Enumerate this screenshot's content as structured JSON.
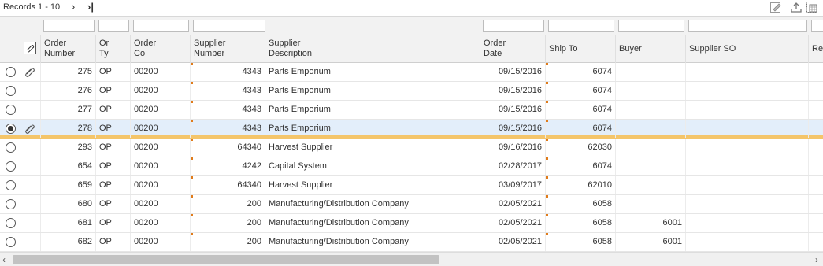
{
  "toolbar": {
    "records_label": "Records 1 - 10",
    "next_glyph": "›",
    "last_glyph": "›|",
    "icons": [
      "personalize-icon",
      "export-icon",
      "grid-format-icon"
    ]
  },
  "columns": [
    {
      "key": "order_number",
      "label": "Order Number"
    },
    {
      "key": "or_ty",
      "label": "Or Ty"
    },
    {
      "key": "order_co",
      "label": "Order Co"
    },
    {
      "key": "supplier_number",
      "label": "Supplier Number"
    },
    {
      "key": "supplier_description",
      "label": "Supplier Description"
    },
    {
      "key": "order_date",
      "label": "Order Date"
    },
    {
      "key": "ship_to",
      "label": "Ship To"
    },
    {
      "key": "buyer",
      "label": "Buyer"
    },
    {
      "key": "supplier_so",
      "label": "Supplier SO"
    },
    {
      "key": "re",
      "label": "Re"
    }
  ],
  "header": {
    "order_number_1": "Order",
    "order_number_2": "Number",
    "or_ty_1": "Or",
    "or_ty_2": "Ty",
    "order_co_1": "Order",
    "order_co_2": "Co",
    "supplier_number_1": "Supplier",
    "supplier_number_2": "Number",
    "supplier_description_1": "Supplier",
    "supplier_description_2": "Description",
    "order_date_1": "Order",
    "order_date_2": "Date",
    "ship_to": "Ship To",
    "buyer": "Buyer",
    "supplier_so": "Supplier SO",
    "re": "Re"
  },
  "rows": [
    {
      "selected": false,
      "attachment": true,
      "order_number": "275",
      "or_ty": "OP",
      "order_co": "00200",
      "supplier_number": "4343",
      "supplier_description": "Parts Emporium",
      "order_date": "09/15/2016",
      "ship_to": "6074",
      "buyer": "",
      "supplier_so": ""
    },
    {
      "selected": false,
      "attachment": false,
      "order_number": "276",
      "or_ty": "OP",
      "order_co": "00200",
      "supplier_number": "4343",
      "supplier_description": "Parts Emporium",
      "order_date": "09/15/2016",
      "ship_to": "6074",
      "buyer": "",
      "supplier_so": ""
    },
    {
      "selected": false,
      "attachment": false,
      "order_number": "277",
      "or_ty": "OP",
      "order_co": "00200",
      "supplier_number": "4343",
      "supplier_description": "Parts Emporium",
      "order_date": "09/15/2016",
      "ship_to": "6074",
      "buyer": "",
      "supplier_so": ""
    },
    {
      "selected": true,
      "attachment": true,
      "order_number": "278",
      "or_ty": "OP",
      "order_co": "00200",
      "supplier_number": "4343",
      "supplier_description": "Parts Emporium",
      "order_date": "09/15/2016",
      "ship_to": "6074",
      "buyer": "",
      "supplier_so": ""
    },
    {
      "selected": false,
      "attachment": false,
      "order_number": "293",
      "or_ty": "OP",
      "order_co": "00200",
      "supplier_number": "64340",
      "supplier_description": "Harvest Supplier",
      "order_date": "09/16/2016",
      "ship_to": "62030",
      "buyer": "",
      "supplier_so": ""
    },
    {
      "selected": false,
      "attachment": false,
      "order_number": "654",
      "or_ty": "OP",
      "order_co": "00200",
      "supplier_number": "4242",
      "supplier_description": "Capital System",
      "order_date": "02/28/2017",
      "ship_to": "6074",
      "buyer": "",
      "supplier_so": ""
    },
    {
      "selected": false,
      "attachment": false,
      "order_number": "659",
      "or_ty": "OP",
      "order_co": "00200",
      "supplier_number": "64340",
      "supplier_description": "Harvest Supplier",
      "order_date": "03/09/2017",
      "ship_to": "62010",
      "buyer": "",
      "supplier_so": ""
    },
    {
      "selected": false,
      "attachment": false,
      "order_number": "680",
      "or_ty": "OP",
      "order_co": "00200",
      "supplier_number": "200",
      "supplier_description": "Manufacturing/Distribution Company",
      "order_date": "02/05/2021",
      "ship_to": "6058",
      "buyer": "",
      "supplier_so": ""
    },
    {
      "selected": false,
      "attachment": false,
      "order_number": "681",
      "or_ty": "OP",
      "order_co": "00200",
      "supplier_number": "200",
      "supplier_description": "Manufacturing/Distribution Company",
      "order_date": "02/05/2021",
      "ship_to": "6058",
      "buyer": "6001",
      "supplier_so": ""
    },
    {
      "selected": false,
      "attachment": false,
      "order_number": "682",
      "or_ty": "OP",
      "order_co": "00200",
      "supplier_number": "200",
      "supplier_description": "Manufacturing/Distribution Company",
      "order_date": "02/05/2021",
      "ship_to": "6058",
      "buyer": "6001",
      "supplier_so": ""
    }
  ],
  "scrollbar": {
    "left_glyph": "‹",
    "right_glyph": "›"
  },
  "colors": {
    "selected_row": "#e3eefa",
    "selected_underline": "#f4c56a",
    "flag": "#e07b1a"
  }
}
